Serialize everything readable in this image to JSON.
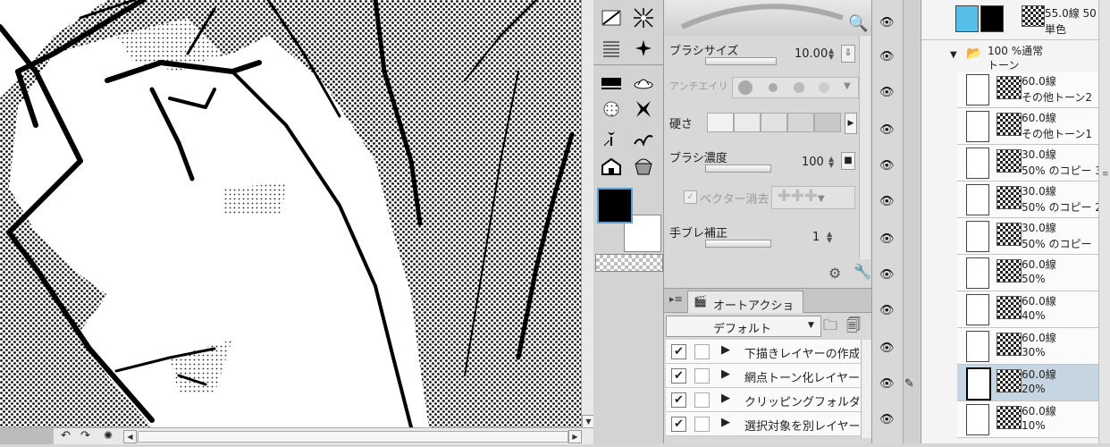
{
  "tool_property": {
    "brush_size_label": "ブラシサイズ",
    "brush_size_value": "10.00",
    "antialias_label": "アンチエイリ",
    "hardness_label": "硬さ",
    "brush_density_label": "ブラシ濃度",
    "brush_density_value": "100",
    "vector_erase_label": "ベクター消去",
    "stabilization_label": "手ブレ補正",
    "stabilization_value": "1"
  },
  "auto_action": {
    "tab_label": "オートアクション",
    "set_name": "デフォルト",
    "items": [
      {
        "label": "下描きレイヤーの作成",
        "checked": true
      },
      {
        "label": "網点トーン化レイヤー",
        "checked": true
      },
      {
        "label": "クリッピングフォルダー化",
        "checked": true
      },
      {
        "label": "選択対象を別レイヤー",
        "checked": true
      }
    ]
  },
  "layers": {
    "top": {
      "line1": "55.0線 50",
      "line2": "単色"
    },
    "folder": {
      "line1": "100 %通常",
      "line2": "トーン"
    },
    "items": [
      {
        "line1": "60.0線",
        "line2": "その他トーン2"
      },
      {
        "line1": "60.0線",
        "line2": "その他トーン1"
      },
      {
        "line1": "30.0線",
        "line2": "50% のコピー 3"
      },
      {
        "line1": "30.0線",
        "line2": "50% のコピー 2"
      },
      {
        "line1": "30.0線",
        "line2": "50% のコピー"
      },
      {
        "line1": "60.0線",
        "line2": "50%"
      },
      {
        "line1": "60.0線",
        "line2": "40%"
      },
      {
        "line1": "60.0線",
        "line2": "30%"
      },
      {
        "line1": "60.0線",
        "line2": "20%"
      },
      {
        "line1": "60.0線",
        "line2": "10%"
      }
    ],
    "selected_index": 8
  },
  "colors": {
    "main": "#000000",
    "sub": "#ffffff",
    "selection": "#c5d6e2"
  }
}
